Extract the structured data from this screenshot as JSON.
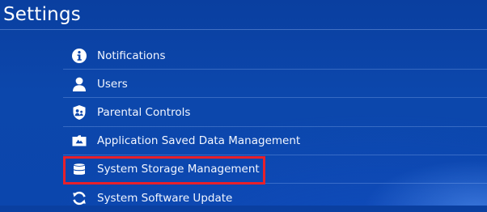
{
  "header": {
    "title": "Settings"
  },
  "menu": {
    "items": [
      {
        "label": "Notifications",
        "icon": "info-icon"
      },
      {
        "label": "Users",
        "icon": "user-icon"
      },
      {
        "label": "Parental Controls",
        "icon": "parental-controls-icon"
      },
      {
        "label": "Application Saved Data Management",
        "icon": "folder-icon"
      },
      {
        "label": "System Storage Management",
        "icon": "storage-icon",
        "highlighted": true
      },
      {
        "label": "System Software Update",
        "icon": "update-icon"
      }
    ]
  },
  "colors": {
    "background": "#0c47ac",
    "text": "#ffffff",
    "highlight_border": "#e8202a"
  }
}
